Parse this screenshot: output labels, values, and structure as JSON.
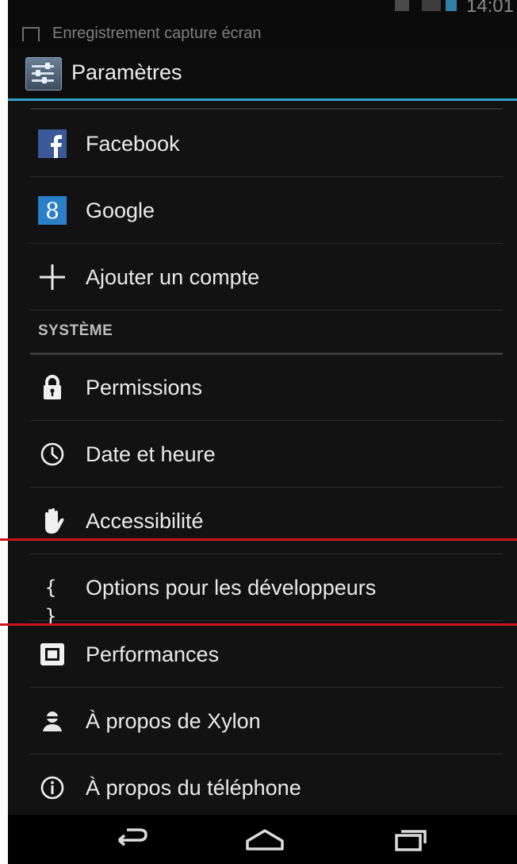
{
  "notification": {
    "text": "Enregistrement capture écran",
    "clock": "14:01"
  },
  "actionbar": {
    "title": "Paramètres",
    "icon": "settings-sliders-icon"
  },
  "accounts": [
    {
      "label": "Facebook",
      "icon": "facebook-icon"
    },
    {
      "label": "Google",
      "icon": "google-icon"
    },
    {
      "label": "Ajouter un compte",
      "icon": "plus-icon"
    }
  ],
  "system_section": {
    "header": "SYSTÈME",
    "items": [
      {
        "label": "Permissions",
        "icon": "lock-icon"
      },
      {
        "label": "Date et heure",
        "icon": "clock-icon"
      },
      {
        "label": "Accessibilité",
        "icon": "hand-icon"
      },
      {
        "label": "Options pour les développeurs",
        "icon": "braces-icon",
        "glyph": "{ }"
      },
      {
        "label": "Performances",
        "icon": "performance-chip-icon"
      },
      {
        "label": "À propos de Xylon",
        "icon": "person-icon"
      },
      {
        "label": "À propos du téléphone",
        "icon": "info-icon"
      }
    ]
  },
  "navbar": {
    "back": "back-icon",
    "home": "home-icon",
    "recents": "recents-icon"
  },
  "colors": {
    "background": "#121212",
    "accent": "#33a6cf",
    "highlight": "#c8161b",
    "text": "#eaeaea"
  }
}
